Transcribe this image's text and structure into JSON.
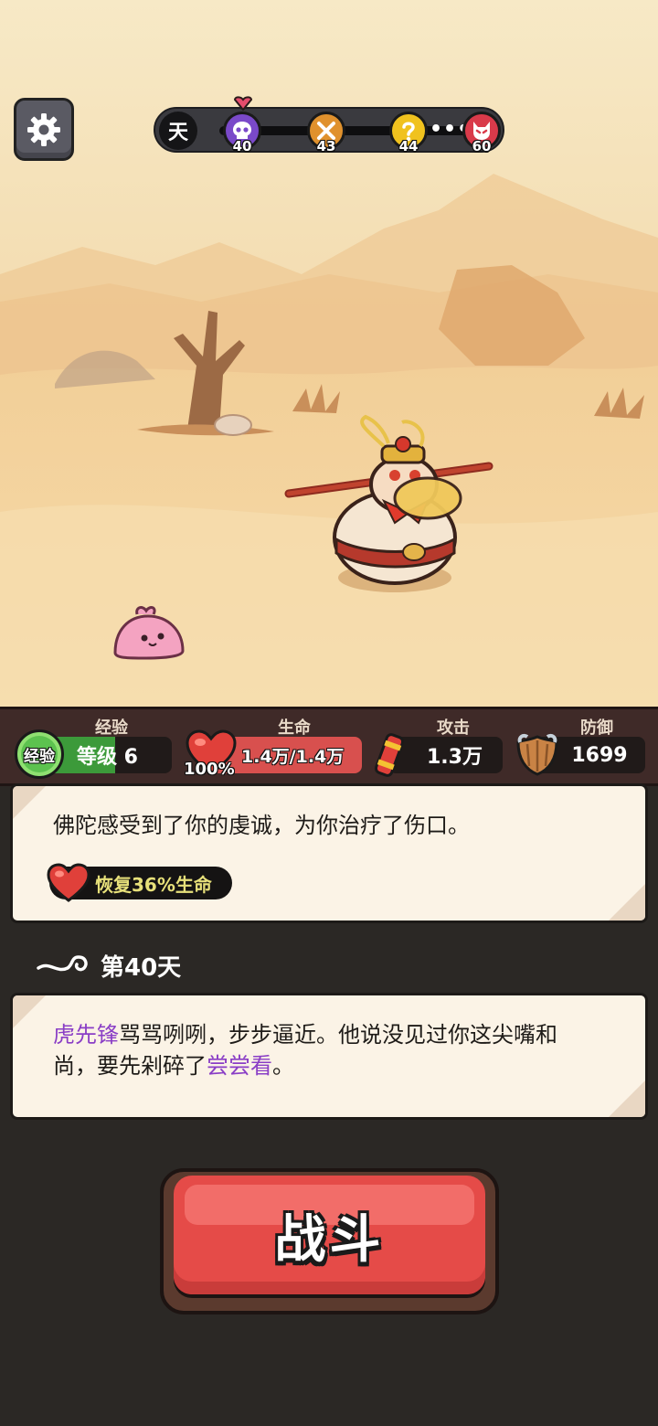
{
  "hud": {
    "day_label": "天",
    "progress_nodes": [
      {
        "name": "skull-boss",
        "day": "40",
        "color": "#7a49c9",
        "current": true
      },
      {
        "name": "crossed-swords",
        "day": "43",
        "color": "#e0912d"
      },
      {
        "name": "question",
        "day": "44",
        "color": "#f0c21e"
      },
      {
        "name": "demon-boss",
        "day": "60",
        "color": "#d93a4a"
      }
    ],
    "ellipsis": "•••"
  },
  "stats": {
    "exp": {
      "label": "经验",
      "badge": "经验",
      "level_text": "等级 6",
      "fill_percent": 55
    },
    "hp": {
      "label": "生命",
      "percent_text": "100%",
      "value_text": "1.4万/1.4万",
      "fill_percent": 100
    },
    "attack": {
      "label": "攻击",
      "value": "1.3万"
    },
    "defense": {
      "label": "防御",
      "value": "1699"
    }
  },
  "event_card": {
    "text": "佛陀感受到了你的虔诚，为你治疗了伤口。",
    "reward": "恢复36%生命"
  },
  "day_header": {
    "title": "第40天"
  },
  "encounter_card": {
    "enemy_name": "虎先锋",
    "text_part1": "骂骂咧咧，步步逼近。他说没见过你这尖嘴和尚，要先剁碎了",
    "highlight": "尝尝看",
    "text_part2": "。"
  },
  "fight_button": {
    "label": "战斗"
  }
}
